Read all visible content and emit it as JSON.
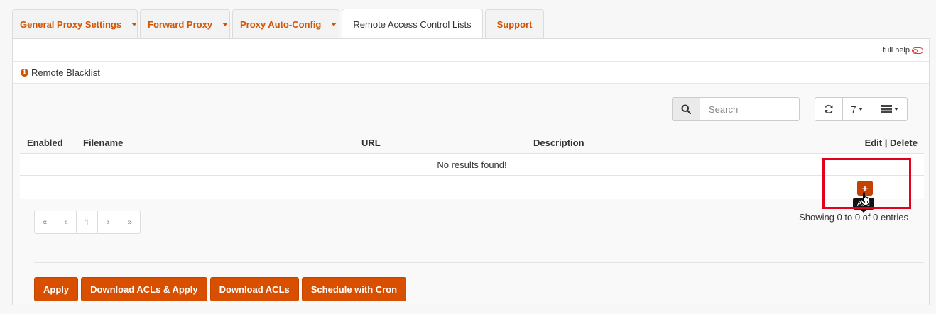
{
  "tabs": [
    {
      "label": "General Proxy Settings",
      "has_dropdown": true,
      "active": false
    },
    {
      "label": "Forward Proxy",
      "has_dropdown": true,
      "active": false
    },
    {
      "label": "Proxy Auto-Config",
      "has_dropdown": true,
      "active": false
    },
    {
      "label": "Remote Access Control Lists",
      "has_dropdown": false,
      "active": true
    },
    {
      "label": "Support",
      "has_dropdown": false,
      "active": false
    }
  ],
  "help": {
    "full_help_label": "full help"
  },
  "section": {
    "title": "Remote Blacklist"
  },
  "toolbar": {
    "search_placeholder": "Search",
    "rows_per_page": "7",
    "icons": {
      "search": "search-icon",
      "refresh": "refresh-icon",
      "columns": "list-icon"
    }
  },
  "table": {
    "columns": [
      "Enabled",
      "Filename",
      "URL",
      "Description",
      "Edit | Delete"
    ],
    "empty_message": "No results found!",
    "add_tooltip": "Add",
    "add_icon": "+"
  },
  "pagination": {
    "first": "«",
    "prev": "‹",
    "page": "1",
    "next": "›",
    "last": "»",
    "info": "Showing 0 to 0 of 0 entries"
  },
  "actions": [
    "Apply",
    "Download ACLs & Apply",
    "Download ACLs",
    "Schedule with Cron"
  ],
  "colors": {
    "accent": "#d94f00",
    "highlight": "#e3001b",
    "link": "#d35400"
  }
}
